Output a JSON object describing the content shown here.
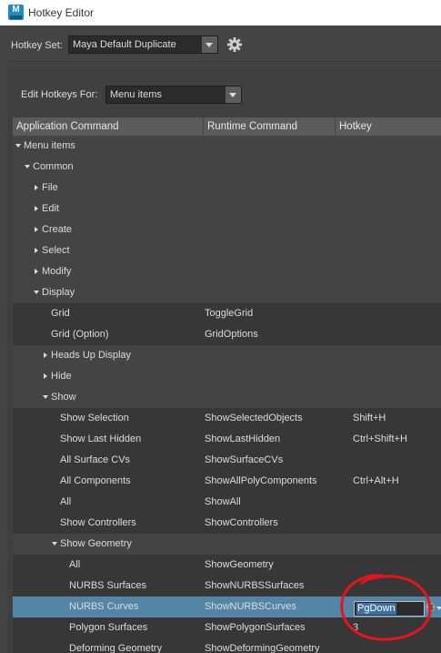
{
  "window": {
    "title": "Hotkey Editor",
    "app_icon": "maya-logo-icon",
    "app_icon_letter": "M"
  },
  "hotkey_set": {
    "label": "Hotkey Set:",
    "value": "Maya Default Duplicate"
  },
  "edit_for": {
    "label": "Edit Hotkeys For:",
    "value": "Menu items"
  },
  "columns": [
    "Application Command",
    "Runtime Command",
    "Hotkey"
  ],
  "rows": [
    {
      "label": "Menu items",
      "indent": 0,
      "arrow": "down",
      "runtime": "",
      "hotkey": "",
      "style": ""
    },
    {
      "label": "Common",
      "indent": 1,
      "arrow": "down",
      "runtime": "",
      "hotkey": "",
      "style": ""
    },
    {
      "label": "File",
      "indent": 2,
      "arrow": "right",
      "runtime": "",
      "hotkey": "",
      "style": ""
    },
    {
      "label": "Edit",
      "indent": 2,
      "arrow": "right",
      "runtime": "",
      "hotkey": "",
      "style": ""
    },
    {
      "label": "Create",
      "indent": 2,
      "arrow": "right",
      "runtime": "",
      "hotkey": "",
      "style": ""
    },
    {
      "label": "Select",
      "indent": 2,
      "arrow": "right",
      "runtime": "",
      "hotkey": "",
      "style": ""
    },
    {
      "label": "Modify",
      "indent": 2,
      "arrow": "right",
      "runtime": "",
      "hotkey": "",
      "style": ""
    },
    {
      "label": "Display",
      "indent": 2,
      "arrow": "down",
      "runtime": "",
      "hotkey": "",
      "style": ""
    },
    {
      "label": "Grid",
      "indent": 3,
      "arrow": "",
      "runtime": "ToggleGrid",
      "hotkey": "",
      "style": "shade"
    },
    {
      "label": "Grid (Option)",
      "indent": 3,
      "arrow": "",
      "runtime": "GridOptions",
      "hotkey": "",
      "style": "shade"
    },
    {
      "label": "Heads Up Display",
      "indent": 3,
      "arrow": "right",
      "runtime": "",
      "hotkey": "",
      "style": ""
    },
    {
      "label": "Hide",
      "indent": 3,
      "arrow": "right",
      "runtime": "",
      "hotkey": "",
      "style": ""
    },
    {
      "label": "Show",
      "indent": 3,
      "arrow": "down",
      "runtime": "",
      "hotkey": "",
      "style": ""
    },
    {
      "label": "Show Selection",
      "indent": 4,
      "arrow": "",
      "runtime": "ShowSelectedObjects",
      "hotkey": "Shift+H",
      "style": "shade"
    },
    {
      "label": "Show Last Hidden",
      "indent": 4,
      "arrow": "",
      "runtime": "ShowLastHidden",
      "hotkey": "Ctrl+Shift+H",
      "style": "shade"
    },
    {
      "label": "All Surface CVs",
      "indent": 4,
      "arrow": "",
      "runtime": "ShowSurfaceCVs",
      "hotkey": "",
      "style": "shade"
    },
    {
      "label": "All Components",
      "indent": 4,
      "arrow": "",
      "runtime": "ShowAllPolyComponents",
      "hotkey": "Ctrl+Alt+H",
      "style": "shade"
    },
    {
      "label": "All",
      "indent": 4,
      "arrow": "",
      "runtime": "ShowAll",
      "hotkey": "",
      "style": "shade"
    },
    {
      "label": "Show Controllers",
      "indent": 4,
      "arrow": "",
      "runtime": "ShowControllers",
      "hotkey": "",
      "style": "shade"
    },
    {
      "label": "Show Geometry",
      "indent": 4,
      "arrow": "down",
      "runtime": "",
      "hotkey": "",
      "style": ""
    },
    {
      "label": "All",
      "indent": 5,
      "arrow": "",
      "runtime": "ShowGeometry",
      "hotkey": "",
      "style": "shade"
    },
    {
      "label": "NURBS Surfaces",
      "indent": 5,
      "arrow": "",
      "runtime": "ShowNURBSSurfaces",
      "hotkey": "",
      "style": "shade"
    },
    {
      "label": "NURBS Curves",
      "indent": 5,
      "arrow": "",
      "runtime": "ShowNURBSCurves",
      "hotkey": "PgDown",
      "style": "sel",
      "editing": true
    },
    {
      "label": "Polygon Surfaces",
      "indent": 5,
      "arrow": "",
      "runtime": "ShowPolygonSurfaces",
      "hotkey": "3",
      "style": "shade"
    },
    {
      "label": "Deforming Geometry",
      "indent": 5,
      "arrow": "",
      "runtime": "ShowDeformingGeometry",
      "hotkey": "",
      "style": "shade"
    }
  ],
  "colors": {
    "selected_row": "#5285a6",
    "annotation": "#e8141c",
    "background": "#444444"
  }
}
